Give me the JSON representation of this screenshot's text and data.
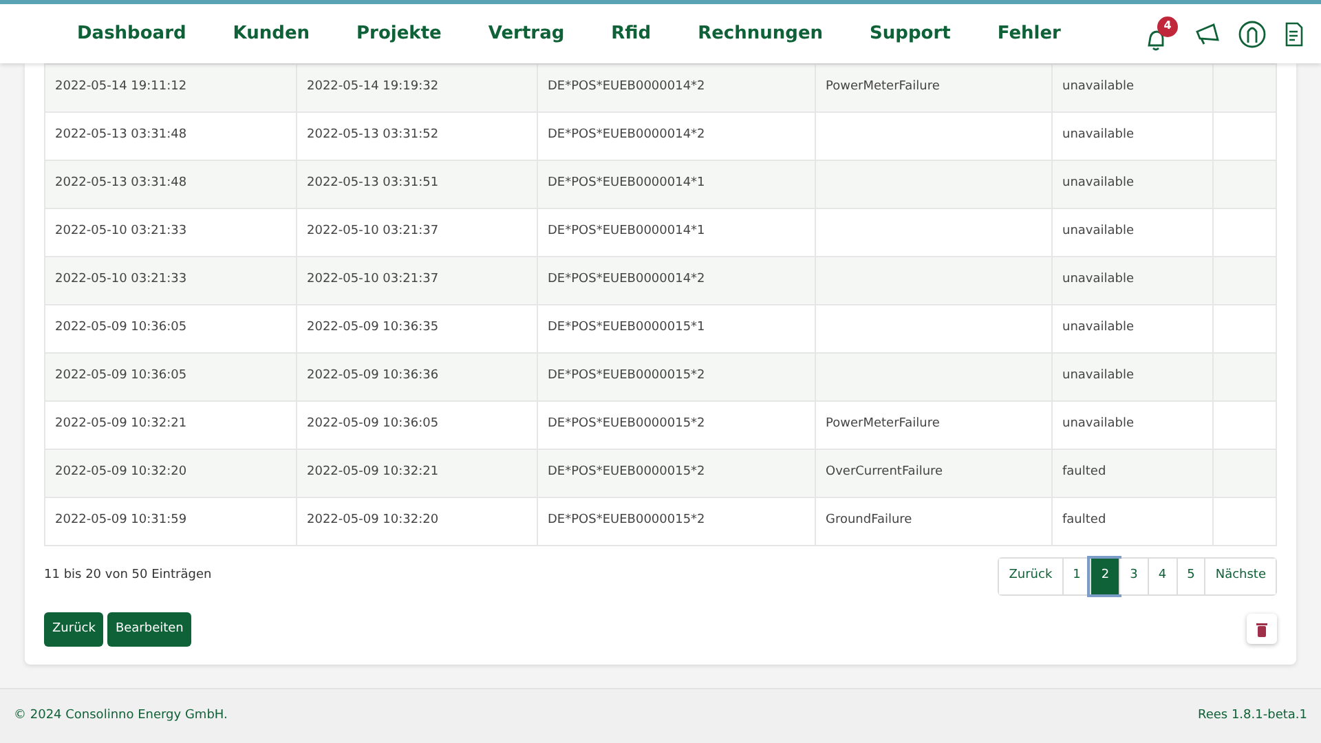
{
  "nav": {
    "items": [
      {
        "label": "Dashboard"
      },
      {
        "label": "Kunden"
      },
      {
        "label": "Projekte"
      },
      {
        "label": "Vertrag"
      },
      {
        "label": "Rfid"
      },
      {
        "label": "Rechnungen"
      },
      {
        "label": "Support"
      },
      {
        "label": "Fehler"
      }
    ],
    "notification_count": "4"
  },
  "table": {
    "rows": [
      {
        "cells": [
          "2022-05-14 19:11:12",
          "2022-05-14 19:19:32",
          "DE*POS*EUEB0000014*2",
          "PowerMeterFailure",
          "unavailable"
        ]
      },
      {
        "cells": [
          "2022-05-13 03:31:48",
          "2022-05-13 03:31:52",
          "DE*POS*EUEB0000014*2",
          "",
          "unavailable"
        ]
      },
      {
        "cells": [
          "2022-05-13 03:31:48",
          "2022-05-13 03:31:51",
          "DE*POS*EUEB0000014*1",
          "",
          "unavailable"
        ]
      },
      {
        "cells": [
          "2022-05-10 03:21:33",
          "2022-05-10 03:21:37",
          "DE*POS*EUEB0000014*1",
          "",
          "unavailable"
        ]
      },
      {
        "cells": [
          "2022-05-10 03:21:33",
          "2022-05-10 03:21:37",
          "DE*POS*EUEB0000014*2",
          "",
          "unavailable"
        ]
      },
      {
        "cells": [
          "2022-05-09 10:36:05",
          "2022-05-09 10:36:35",
          "DE*POS*EUEB0000015*1",
          "",
          "unavailable"
        ]
      },
      {
        "cells": [
          "2022-05-09 10:36:05",
          "2022-05-09 10:36:36",
          "DE*POS*EUEB0000015*2",
          "",
          "unavailable"
        ]
      },
      {
        "cells": [
          "2022-05-09 10:32:21",
          "2022-05-09 10:36:05",
          "DE*POS*EUEB0000015*2",
          "PowerMeterFailure",
          "unavailable"
        ]
      },
      {
        "cells": [
          "2022-05-09 10:32:20",
          "2022-05-09 10:32:21",
          "DE*POS*EUEB0000015*2",
          "OverCurrentFailure",
          "faulted"
        ]
      },
      {
        "cells": [
          "2022-05-09 10:31:59",
          "2022-05-09 10:32:20",
          "DE*POS*EUEB0000015*2",
          "GroundFailure",
          "faulted"
        ]
      }
    ]
  },
  "info": "11 bis 20 von 50 Einträgen",
  "pagination": [
    {
      "label": "Zurück",
      "selected": false
    },
    {
      "label": "1",
      "selected": false
    },
    {
      "label": "2",
      "selected": true
    },
    {
      "label": "3",
      "selected": false
    },
    {
      "label": "4",
      "selected": false
    },
    {
      "label": "5",
      "selected": false
    },
    {
      "label": "Nächste",
      "selected": false
    }
  ],
  "buttons": [
    "Zurück",
    "Bearbeiten"
  ],
  "footer": {
    "copyright": "© 2024 Consolinno Energy GmbH.",
    "version": "Rees 1.8.1-beta.1"
  }
}
